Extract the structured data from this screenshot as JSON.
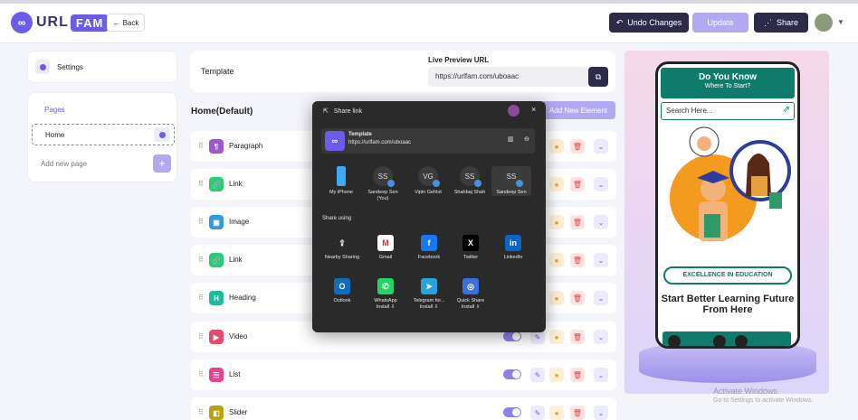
{
  "topbar": {
    "logo_url": "URL",
    "logo_fam": "FAM",
    "back_label": "Back",
    "undo_label": "Undo Changes",
    "update_label": "Update",
    "share_label": "Share"
  },
  "sidebar": {
    "settings_label": "Settings",
    "pages_title": "Pages",
    "home_label": "Home",
    "add_page_placeholder": "Add new page"
  },
  "template": {
    "label": "Template",
    "live_preview_label": "Live Preview URL",
    "live_preview_url": "https://urlfam.com/uboaac"
  },
  "elements": {
    "section_title": "Home(Default)",
    "add_label": "Add New Element",
    "items": [
      {
        "name": "Paragraph",
        "icon": "paragraph-icon",
        "color": "#9b59d0"
      },
      {
        "name": "Link",
        "icon": "link-icon",
        "color": "#2ecc71"
      },
      {
        "name": "Image",
        "icon": "image-icon",
        "color": "#3498db"
      },
      {
        "name": "Link",
        "icon": "link-icon",
        "color": "#2ecc71"
      },
      {
        "name": "Heading",
        "icon": "heading-icon",
        "color": "#1abc9c"
      },
      {
        "name": "Video",
        "icon": "video-icon",
        "color": "#e74c6c"
      },
      {
        "name": "List",
        "icon": "list-icon",
        "color": "#e84393"
      },
      {
        "name": "Slider",
        "icon": "slider-icon",
        "color": "#b8a30a"
      }
    ]
  },
  "preview": {
    "title": "Do You Know",
    "subtitle": "Where To Start?",
    "search_placeholder": "Search Here...",
    "excellence": "EXCELLENCE IN EDUCATION",
    "tagline": "Start Better Learning Future From Here"
  },
  "share_dialog": {
    "title": "Share link",
    "close": "×",
    "item_title": "Template",
    "item_url": "https://urlfam.com/uboaac",
    "contacts": [
      {
        "initials": "",
        "name": "My iPhone",
        "sub": ""
      },
      {
        "initials": "SS",
        "name": "Sandeep Sen",
        "sub": "(You)"
      },
      {
        "initials": "VG",
        "name": "Vipin Gehlot",
        "sub": ""
      },
      {
        "initials": "SS",
        "name": "Shahbaj Shah",
        "sub": ""
      },
      {
        "initials": "SS",
        "name": "Sandeep Sen",
        "sub": ""
      }
    ],
    "share_using_label": "Share using",
    "apps": [
      {
        "name": "Nearby Sharing",
        "sub": "",
        "color": "#2a2a2a",
        "glyph": "⇪"
      },
      {
        "name": "Gmail",
        "sub": "",
        "color": "#ffffff",
        "glyph": "M"
      },
      {
        "name": "Facebook",
        "sub": "",
        "color": "#1877f2",
        "glyph": "f"
      },
      {
        "name": "Twitter",
        "sub": "",
        "color": "#000000",
        "glyph": "X"
      },
      {
        "name": "LinkedIn",
        "sub": "",
        "color": "#0a66c2",
        "glyph": "in"
      },
      {
        "name": "Outlook",
        "sub": "",
        "color": "#0f6cbd",
        "glyph": "O"
      },
      {
        "name": "WhatsApp",
        "sub": "Install ⇩",
        "color": "#25d366",
        "glyph": "✆"
      },
      {
        "name": "Telegram for...",
        "sub": "Install ⇩",
        "color": "#2aa3dc",
        "glyph": "➤"
      },
      {
        "name": "Quick Share",
        "sub": "Install ⇩",
        "color": "#3b6fe0",
        "glyph": "◎"
      }
    ]
  },
  "watermark": {
    "line1": "Activate Windows",
    "line2": "Go to Settings to activate Windows."
  }
}
